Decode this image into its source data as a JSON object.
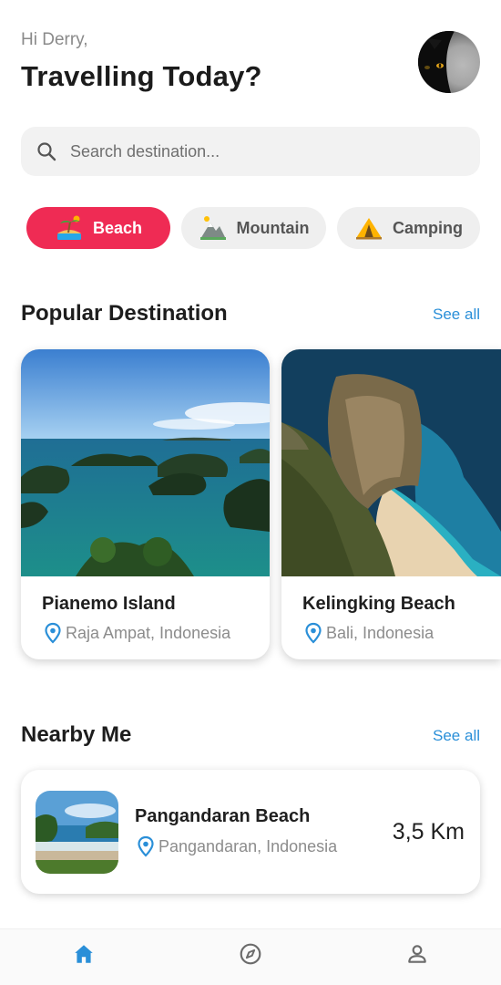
{
  "header": {
    "greeting": "Hi Derry,",
    "headline": "Travelling Today?",
    "avatar_icon": "black-cat-avatar"
  },
  "search": {
    "placeholder": "Search destination...",
    "value": "",
    "icon": "search-icon"
  },
  "categories": [
    {
      "label": "Beach",
      "icon": "beach-icon",
      "active": true
    },
    {
      "label": "Mountain",
      "icon": "mountain-icon",
      "active": false
    },
    {
      "label": "Camping",
      "icon": "tent-icon",
      "active": false
    }
  ],
  "popular": {
    "title": "Popular Destination",
    "see_all": "See all",
    "items": [
      {
        "name": "Pianemo Island",
        "location": "Raja Ampat, Indonesia"
      },
      {
        "name": "Kelingking Beach",
        "location": "Bali, Indonesia"
      }
    ]
  },
  "nearby": {
    "title": "Nearby Me",
    "see_all": "See all",
    "items": [
      {
        "name": "Pangandaran Beach",
        "location": "Pangandaran, Indonesia",
        "distance": "3,5 Km"
      }
    ]
  },
  "nav": {
    "items": [
      {
        "icon": "home-icon",
        "active": true
      },
      {
        "icon": "compass-icon",
        "active": false
      },
      {
        "icon": "user-icon",
        "active": false
      }
    ]
  },
  "colors": {
    "accent": "#ef2b54",
    "link": "#2a8fd8",
    "pin": "#2a8fd8",
    "nav_active": "#2a8fd8",
    "nav_inactive": "#6b6b6b"
  }
}
